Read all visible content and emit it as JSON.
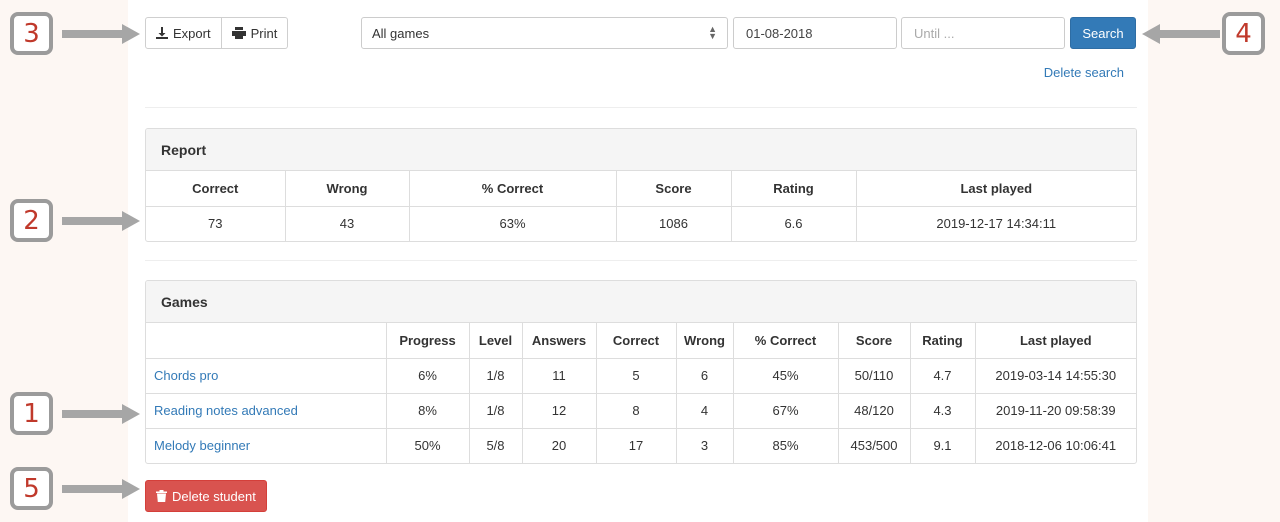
{
  "toolbar": {
    "export_label": "Export",
    "print_label": "Print",
    "game_select_value": "All games",
    "date_from_value": "01-08-2018",
    "date_until_placeholder": "Until ...",
    "search_label": "Search",
    "delete_search_label": "Delete search"
  },
  "report": {
    "title": "Report",
    "headers": [
      "Correct",
      "Wrong",
      "% Correct",
      "Score",
      "Rating",
      "Last played"
    ],
    "row": [
      "73",
      "43",
      "63%",
      "1086",
      "6.6",
      "2019-12-17 14:34:11"
    ]
  },
  "games": {
    "title": "Games",
    "headers": [
      "",
      "Progress",
      "Level",
      "Answers",
      "Correct",
      "Wrong",
      "% Correct",
      "Score",
      "Rating",
      "Last played"
    ],
    "rows": [
      [
        "Chords pro",
        "6%",
        "1/8",
        "11",
        "5",
        "6",
        "45%",
        "50/110",
        "4.7",
        "2019-03-14 14:55:30"
      ],
      [
        "Reading notes advanced",
        "8%",
        "1/8",
        "12",
        "8",
        "4",
        "67%",
        "48/120",
        "4.3",
        "2019-11-20 09:58:39"
      ],
      [
        "Melody beginner",
        "50%",
        "5/8",
        "20",
        "17",
        "3",
        "85%",
        "453/500",
        "9.1",
        "2018-12-06 10:06:41"
      ]
    ]
  },
  "delete_student_label": "Delete student",
  "callouts": [
    "3",
    "2",
    "1",
    "5",
    "4"
  ],
  "colors": {
    "primary": "#337ab7",
    "danger": "#d9534f",
    "callout_number": "#c0392b"
  }
}
